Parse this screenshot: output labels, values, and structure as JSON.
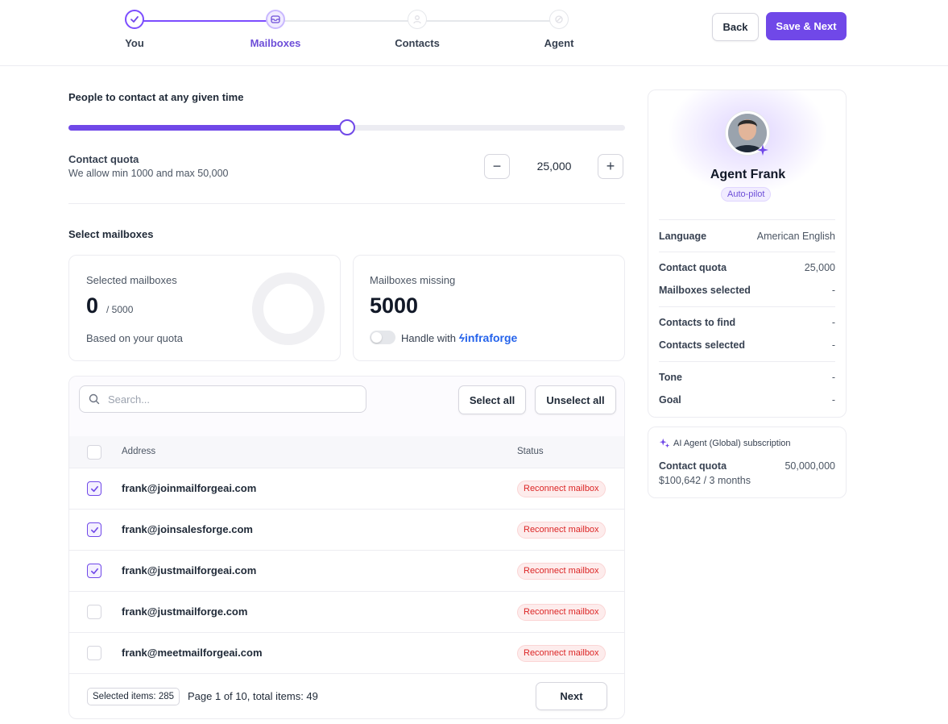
{
  "header": {
    "steps": [
      {
        "label": "You",
        "state": "done",
        "icon": "check-icon"
      },
      {
        "label": "Mailboxes",
        "state": "active",
        "icon": "mailbox-icon"
      },
      {
        "label": "Contacts",
        "state": "todo",
        "icon": "contacts-icon"
      },
      {
        "label": "Agent",
        "state": "todo",
        "icon": "agent-icon"
      }
    ],
    "back_label": "Back",
    "save_label": "Save & Next"
  },
  "contact": {
    "title": "People to contact at any given time",
    "slider_fraction": 0.5,
    "quota_title": "Contact quota",
    "quota_sub": "We allow min 1000 and max 50,000",
    "quota_value": "25,000",
    "minus": "−",
    "plus": "+"
  },
  "mailboxes": {
    "title": "Select mailboxes",
    "selected_card": {
      "label": "Selected mailboxes",
      "count": "0",
      "total": "/ 5000",
      "note": "Based on your quota"
    },
    "missing_card": {
      "label": "Mailboxes missing",
      "count": "5000",
      "toggle_label": "Handle with",
      "brand": "infraforge",
      "toggle_on": false
    }
  },
  "table": {
    "search_placeholder": "Search...",
    "select_all": "Select all",
    "unselect_all": "Unselect all",
    "col_address": "Address",
    "col_status": "Status",
    "rows": [
      {
        "address": "frank@joinmailforgeai.com",
        "status": "Reconnect mailbox",
        "checked": true
      },
      {
        "address": "frank@joinsalesforge.com",
        "status": "Reconnect mailbox",
        "checked": true
      },
      {
        "address": "frank@justmailforgeai.com",
        "status": "Reconnect mailbox",
        "checked": true
      },
      {
        "address": "frank@justmailforge.com",
        "status": "Reconnect mailbox",
        "checked": false
      },
      {
        "address": "frank@meetmailforgeai.com",
        "status": "Reconnect mailbox",
        "checked": false
      }
    ],
    "selected_items": "Selected items: 285",
    "page_info": "Page 1 of 10, total items: 49",
    "next_label": "Next"
  },
  "agent": {
    "name": "Agent Frank",
    "mode": "Auto-pilot",
    "details": {
      "language_label": "Language",
      "language_value": "American English",
      "quota_label": "Contact quota",
      "quota_value": "25,000",
      "mailboxes_label": "Mailboxes selected",
      "mailboxes_value": "-",
      "find_label": "Contacts to find",
      "find_value": "-",
      "selected_label": "Contacts selected",
      "selected_value": "-",
      "tone_label": "Tone",
      "tone_value": "-",
      "goal_label": "Goal",
      "goal_value": "-"
    }
  },
  "subscription": {
    "title": "AI Agent (Global) subscription",
    "quota_label": "Contact quota",
    "quota_value": "50,000,000",
    "price": "$100,642 / 3 months"
  },
  "colors": {
    "accent": "#7048e8",
    "accent_light": "#f1ecff",
    "danger": "#dc2626",
    "brand_blue": "#2563eb"
  }
}
